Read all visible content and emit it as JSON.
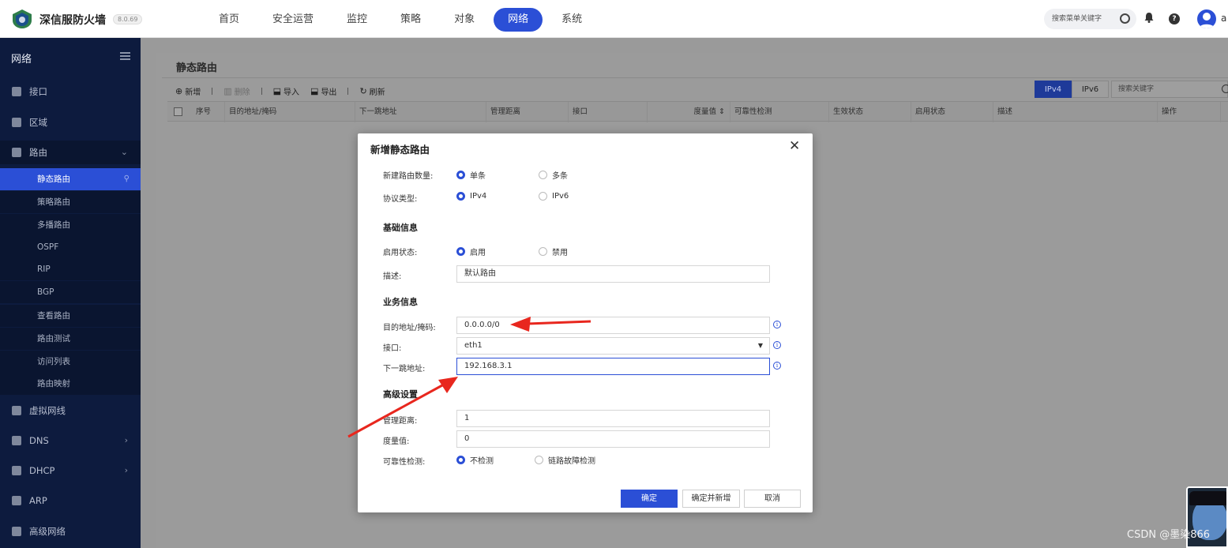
{
  "app": {
    "brand": "深信服防火墙",
    "version": "8.0.69",
    "nav": [
      "首页",
      "安全运营",
      "监控",
      "策略",
      "对象",
      "网络",
      "系统"
    ],
    "active_nav": "网络",
    "search_placeholder": "搜索菜单关键字",
    "user_initial": "a"
  },
  "sidebar": {
    "title": "网络",
    "items": [
      {
        "label": "接口"
      },
      {
        "label": "区域"
      },
      {
        "label": "路由",
        "expanded": true
      },
      {
        "label": "虚拟网线"
      },
      {
        "label": "DNS"
      },
      {
        "label": "DHCP"
      },
      {
        "label": "ARP"
      },
      {
        "label": "高级网络"
      }
    ],
    "route_sub": [
      "静态路由",
      "策略路由",
      "多播路由",
      "OSPF",
      "RIP",
      "BGP",
      "查看路由",
      "路由测试",
      "访问列表",
      "路由映射"
    ],
    "active_sub": "静态路由"
  },
  "page": {
    "title": "静态路由",
    "toolbar": {
      "add": "新增",
      "delete": "删除",
      "import": "导入",
      "export": "导出",
      "refresh": "刷新"
    },
    "ip_tabs": [
      "IPv4",
      "IPv6"
    ],
    "active_ip_tab": "IPv4",
    "search_placeholder": "搜索关键字",
    "columns": [
      "序号",
      "目的地址/掩码",
      "下一跳地址",
      "管理距离",
      "接口",
      "度量值",
      "可靠性检测",
      "生效状态",
      "启用状态",
      "描述",
      "操作"
    ]
  },
  "modal": {
    "title": "新增静态路由",
    "route_count_label": "新建路由数量:",
    "route_count_options": [
      "单条",
      "多条"
    ],
    "route_count_selected": "单条",
    "protocol_label": "协议类型:",
    "protocol_options": [
      "IPv4",
      "IPv6"
    ],
    "protocol_selected": "IPv4",
    "section_basic": "基础信息",
    "enable_label": "启用状态:",
    "enable_options": [
      "启用",
      "禁用"
    ],
    "enable_selected": "启用",
    "desc_label": "描述:",
    "desc_value": "默认路由",
    "section_business": "业务信息",
    "dest_label": "目的地址/掩码:",
    "dest_value": "0.0.0.0/0",
    "iface_label": "接口:",
    "iface_value": "eth1",
    "nexthop_label": "下一跳地址:",
    "nexthop_value": "192.168.3.1",
    "section_advanced": "高级设置",
    "distance_label": "管理距离:",
    "distance_value": "1",
    "metric_label": "度量值:",
    "metric_value": "0",
    "detect_label": "可靠性检测:",
    "detect_options": [
      "不检测",
      "链路故障检测"
    ],
    "detect_selected": "不检测",
    "btn_ok": "确定",
    "btn_ok_new": "确定并新增",
    "btn_cancel": "取消"
  },
  "watermark": "CSDN @墨染866",
  "colors": {
    "accent": "#2b4fd6",
    "sidebar_bg": "#0d1b3e",
    "annotation_arrow": "#e8271e"
  }
}
